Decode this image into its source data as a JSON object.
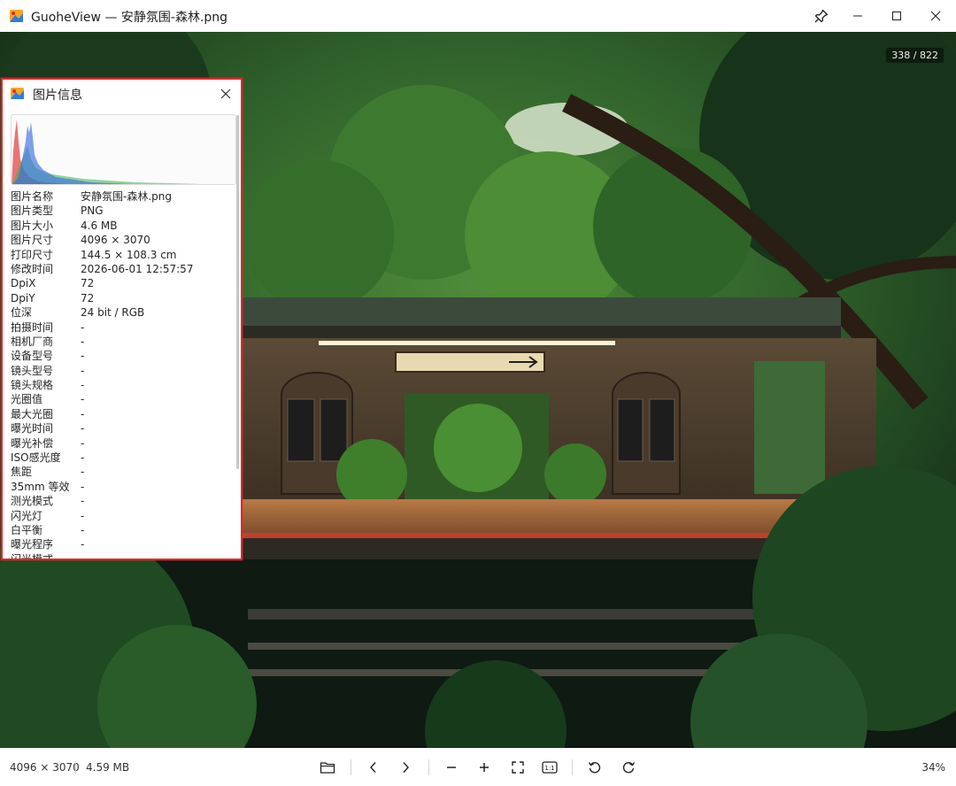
{
  "window": {
    "app_name": "GuoheView",
    "title": "GuoheView — 安静氛围-森林.png",
    "pin_icon": "pin-icon",
    "minimize_icon": "minimize-icon",
    "maximize_icon": "maximize-icon",
    "close_icon": "close-icon"
  },
  "viewer": {
    "page_counter": "338 / 822"
  },
  "info_panel": {
    "title": "图片信息",
    "close_icon": "close-icon",
    "histogram_colors": {
      "red": "#e23b3b",
      "green": "#37b24d",
      "blue": "#3b6fe2"
    },
    "rows": [
      {
        "key": "图片名称",
        "value": "安静氛围-森林.png"
      },
      {
        "key": "图片类型",
        "value": "PNG"
      },
      {
        "key": "图片大小",
        "value": "4.6 MB"
      },
      {
        "key": "图片尺寸",
        "value": "4096 × 3070"
      },
      {
        "key": "打印尺寸",
        "value": "144.5 × 108.3 cm"
      },
      {
        "key": "修改时间",
        "value": "2026-06-01 12:57:57"
      },
      {
        "key": "DpiX",
        "value": "72"
      },
      {
        "key": "DpiY",
        "value": "72"
      },
      {
        "key": "位深",
        "value": "24 bit / RGB"
      },
      {
        "key": "拍摄时间",
        "value": "-"
      },
      {
        "key": "相机厂商",
        "value": "-"
      },
      {
        "key": "设备型号",
        "value": "-"
      },
      {
        "key": "镜头型号",
        "value": "-"
      },
      {
        "key": "镜头规格",
        "value": "-"
      },
      {
        "key": "光圈值",
        "value": "-"
      },
      {
        "key": "最大光圈",
        "value": "-"
      },
      {
        "key": "曝光时间",
        "value": "-"
      },
      {
        "key": "曝光补偿",
        "value": "-"
      },
      {
        "key": "ISO感光度",
        "value": "-"
      },
      {
        "key": "焦距",
        "value": "-"
      },
      {
        "key": "35mm 等效",
        "value": "-"
      },
      {
        "key": "测光模式",
        "value": "-"
      },
      {
        "key": "闪光灯",
        "value": "-"
      },
      {
        "key": "白平衡",
        "value": "-"
      },
      {
        "key": "曝光程序",
        "value": "-"
      },
      {
        "key": "闪光模式",
        "value": "-"
      }
    ]
  },
  "statusbar": {
    "dimensions": "4096 × 3070",
    "file_size": "4.59 MB",
    "zoom": "34%",
    "tools": [
      "folder-icon",
      "previous-icon",
      "next-icon",
      "zoom-out-icon",
      "zoom-in-icon",
      "fit-screen-icon",
      "actual-size-icon",
      "rotate-left-icon",
      "rotate-right-icon"
    ],
    "actual_size_label": "1:1"
  },
  "colors": {
    "accent": "#e5262b",
    "viewer_bg": "#0c1a10"
  }
}
